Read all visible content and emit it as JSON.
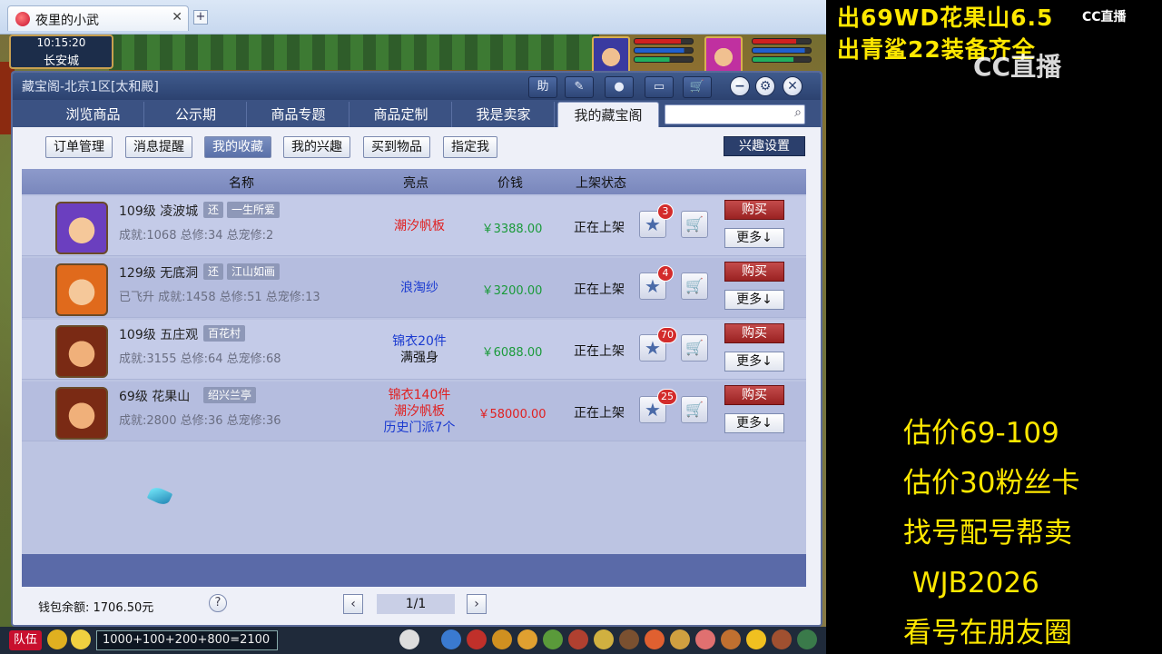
{
  "browser": {
    "tab_title": "夜里的小武",
    "close_glyph": "✕",
    "new_tab_glyph": "+"
  },
  "game": {
    "time": "10:15:20",
    "location": "长安城",
    "chat_input": "1000+100+200+800=2100",
    "team_label": "队伍"
  },
  "panel": {
    "title": "藏宝阁-北京1区[太和殿]",
    "toolbar": {
      "help": "助",
      "edit_icon": "pencil-icon",
      "record_icon": "record-icon",
      "chat_icon": "chat-bubble-icon",
      "cart_icon": "cart-icon"
    },
    "window_btns": {
      "minimize": "−",
      "settings": "⚙",
      "close": "✕"
    },
    "nav_tabs": [
      {
        "label": "浏览商品"
      },
      {
        "label": "公示期"
      },
      {
        "label": "商品专题"
      },
      {
        "label": "商品定制"
      },
      {
        "label": "我是卖家"
      },
      {
        "label": "我的藏宝阁"
      }
    ],
    "active_tab": 5,
    "search": {
      "value": "",
      "placeholder": ""
    },
    "sub_buttons": [
      {
        "label": "订单管理"
      },
      {
        "label": "消息提醒"
      },
      {
        "label": "我的收藏"
      },
      {
        "label": "我的兴趣"
      },
      {
        "label": "买到物品"
      },
      {
        "label": "指定我"
      }
    ],
    "active_sub": 2,
    "interest_setting": "兴趣设置",
    "columns": {
      "name": "名称",
      "highlight": "亮点",
      "price": "价钱",
      "status": "上架状态"
    },
    "rows": [
      {
        "level": "109级",
        "school": "凌波城",
        "tag1": "还",
        "tag2": "一生所爱",
        "stats": "成就:1068 总修:34 总宠修:2",
        "highlight": [
          "潮汐帆板"
        ],
        "hl_color": [
          "#e02020"
        ],
        "price": "￥3388.00",
        "price_color": "#1a9a3a",
        "status": "正在上架",
        "fav": "3",
        "buy": "购买",
        "more": "更多↓",
        "avatar": "purple"
      },
      {
        "level": "129级",
        "school": "无底洞",
        "tag1": "还",
        "tag2": "江山如画",
        "stats": "已飞升 成就:1458 总修:51 总宠修:13",
        "highlight": [
          "浪淘纱"
        ],
        "hl_color": [
          "#1a3ad0"
        ],
        "price": "￥3200.00",
        "price_color": "#1a9a3a",
        "status": "正在上架",
        "fav": "4",
        "buy": "购买",
        "more": "更多↓",
        "avatar": "orange"
      },
      {
        "level": "109级",
        "school": "五庄观",
        "tag1": "",
        "tag2": "百花村",
        "stats": "成就:3155 总修:64 总宠修:68",
        "highlight": [
          "锦衣20件",
          "满强身"
        ],
        "hl_color": [
          "#1a3ad0",
          "#111111"
        ],
        "price": "￥6088.00",
        "price_color": "#1a9a3a",
        "status": "正在上架",
        "fav": "70",
        "buy": "购买",
        "more": "更多↓",
        "avatar": "brown"
      },
      {
        "level": "69级",
        "school": "花果山",
        "tag1": "",
        "tag2": "绍兴兰亭",
        "stats": "成就:2800 总修:36 总宠修:36",
        "highlight": [
          "锦衣140件",
          "潮汐帆板",
          "历史门派7个"
        ],
        "hl_color": [
          "#e02020",
          "#e02020",
          "#1a3ad0"
        ],
        "price": "￥58000.00",
        "price_color": "#e02020",
        "status": "正在上架",
        "fav": "25",
        "buy": "购买",
        "more": "更多↓",
        "avatar": "brown"
      }
    ],
    "wallet": "钱包余额: 1706.50元",
    "help_glyph": "?",
    "pagination": {
      "prev": "‹",
      "next": "›",
      "info": "1/1"
    }
  },
  "overlay": {
    "top_line1": "出69WD花果山6.5",
    "top_line2": "出青鲨22装备齐全",
    "logo": "CC直播",
    "watermark": "CC直播",
    "info_lines": [
      "估价69-109",
      "估价30粉丝卡",
      "找号配号帮卖",
      " WJB2026",
      "看号在朋友圈"
    ]
  }
}
